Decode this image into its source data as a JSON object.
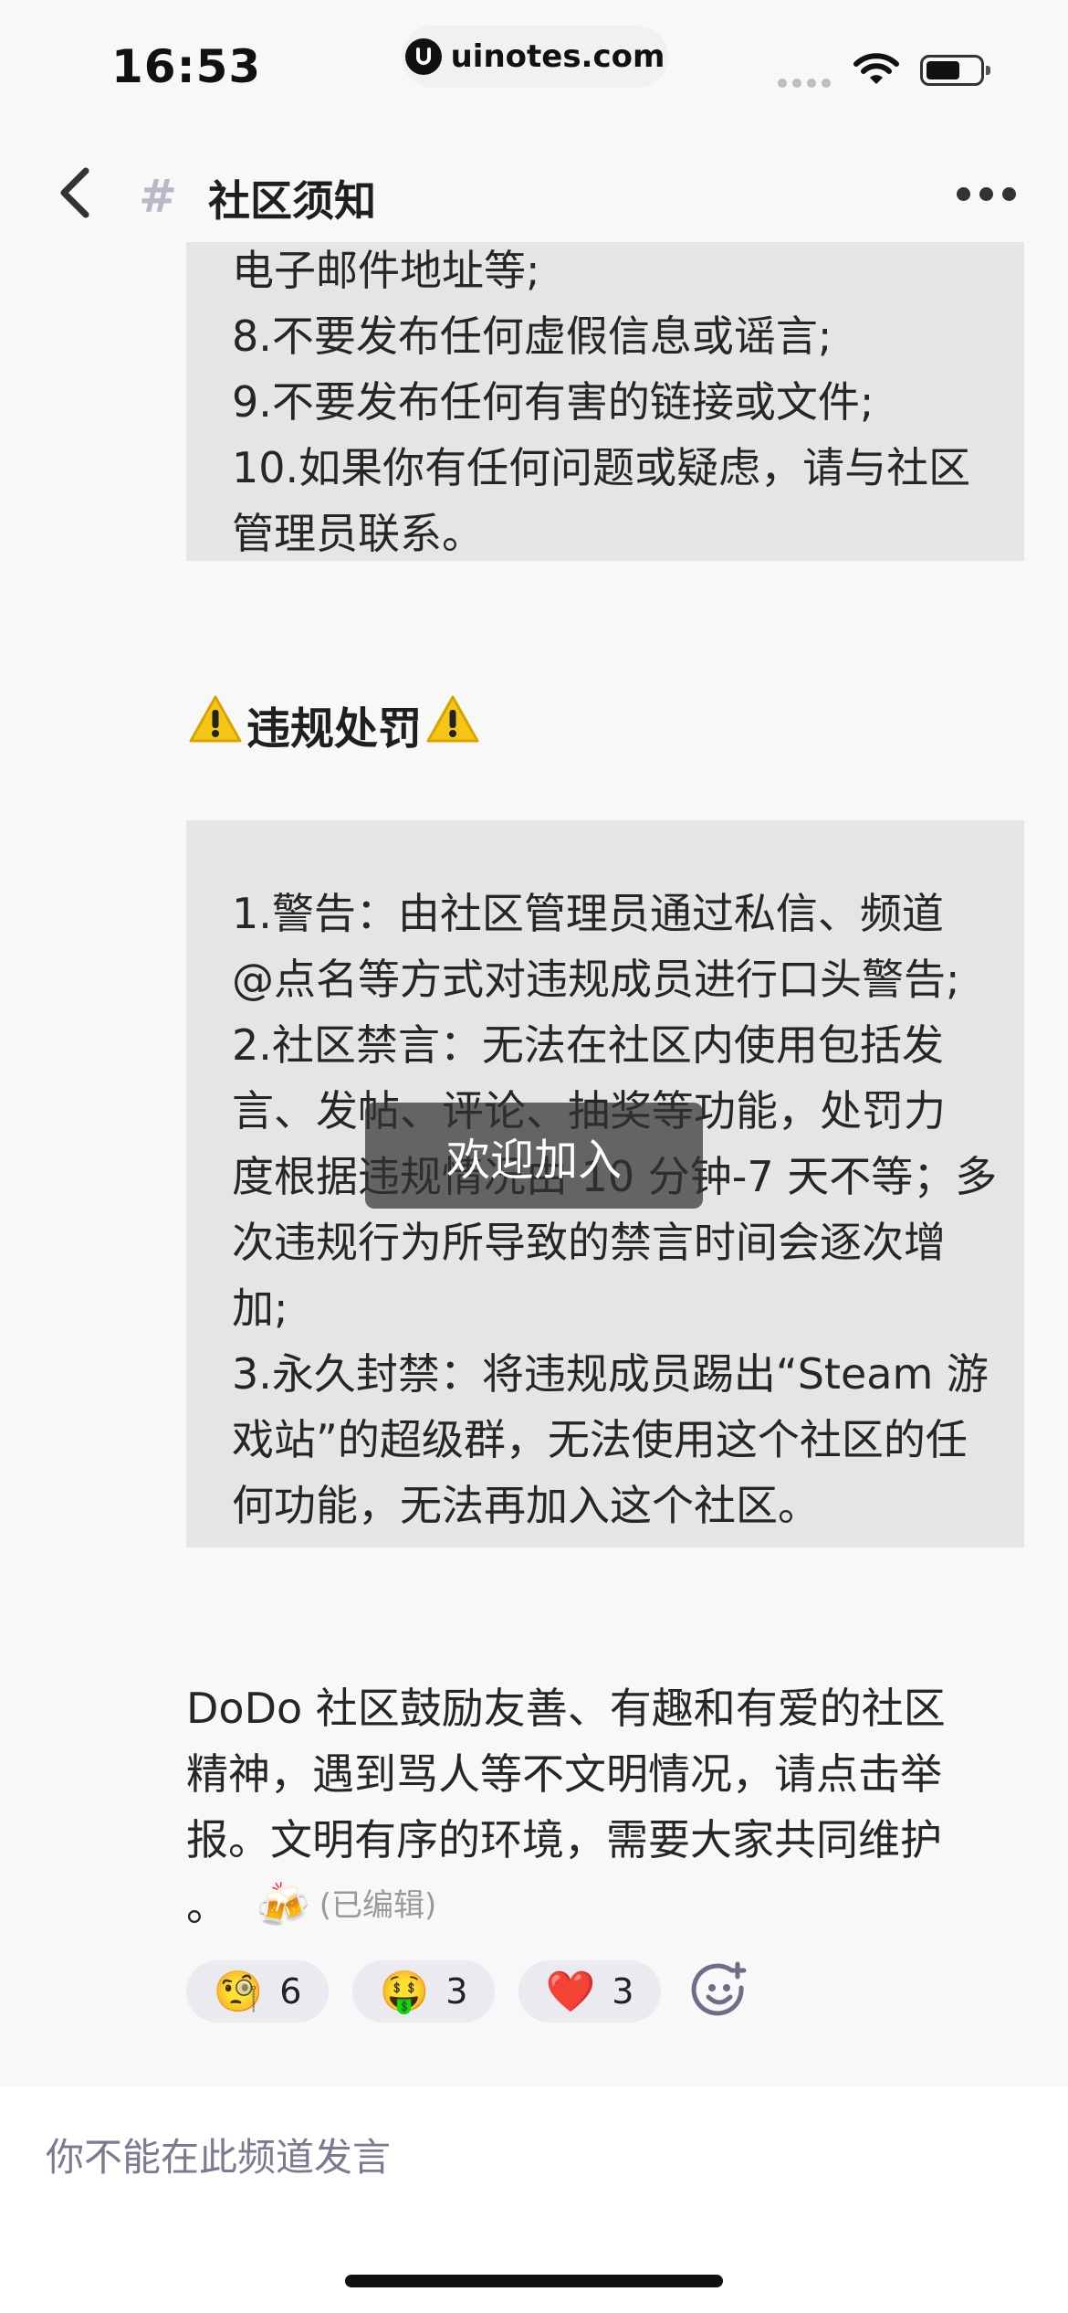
{
  "status_bar": {
    "time": "16:53",
    "url": "uinotes.com"
  },
  "header": {
    "hash_symbol": "#",
    "title": "社区须知"
  },
  "rules_block": {
    "lines": [
      "电子邮件地址等;",
      "8.不要发布任何虚假信息或谣言;",
      "9.不要发布任何有害的链接或文件;",
      "10.如果你有任何问题或疑虑，请与社区",
      "管理员联系。"
    ]
  },
  "penalty_section": {
    "heading": "违规处罚",
    "lines": [
      "1.警告：由社区管理员通过私信、频道",
      "@点名等方式对违规成员进行口头警告;",
      "2.社区禁言：无法在社区内使用包括发",
      "言、发帖、评论、抽奖等功能，处罚力",
      "度根据违规情况由 10 分钟-7 天不等；多",
      "次违规行为所导致的禁言时间会逐次增",
      "加;",
      "3.永久封禁：将违规成员踢出“Steam 游",
      "戏站”的超级群，无法使用这个社区的任",
      "何功能，无法再加入这个社区。"
    ]
  },
  "closing": {
    "lines": [
      " DoDo 社区鼓励友善、有趣和有爱的社区",
      "精神，遇到骂人等不文明情况，请点击举",
      "报。文明有序的环境，需要大家共同维护",
      "。"
    ],
    "emoji": "🍻",
    "edited_label": "(已编辑)"
  },
  "reactions": [
    {
      "emoji": "🧐",
      "count": "6"
    },
    {
      "emoji": "🤑",
      "count": "3"
    },
    {
      "emoji": "❤️",
      "count": "3"
    }
  ],
  "toast": {
    "text": "欢迎加入"
  },
  "bottom_bar": {
    "notice": "你不能在此频道发言"
  },
  "icons": {
    "back": "chevron-left-icon",
    "more": "more-dots-icon",
    "warning": "warning-icon",
    "add_reaction": "add-emoji-icon",
    "wifi": "wifi-icon",
    "battery": "battery-icon"
  }
}
